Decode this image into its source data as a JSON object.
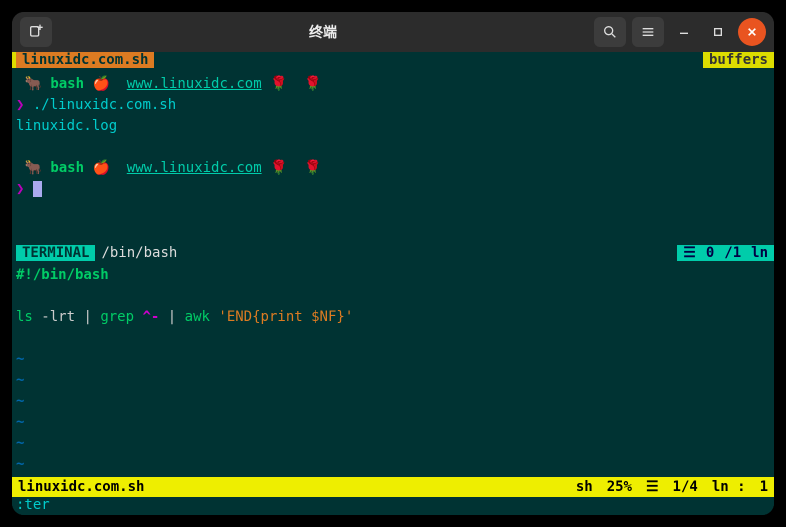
{
  "titlebar": {
    "title": "终端"
  },
  "tabline": {
    "active": "linuxidc.com.sh",
    "right": "buffers"
  },
  "upper": {
    "bash_word": "bash",
    "url": "www.linuxidc.com",
    "prompt_symbol": "❯",
    "command": "./linuxidc.com.sh",
    "output": "linuxidc.log"
  },
  "midbar": {
    "mode": "TERMINAL",
    "path": "/bin/bash",
    "hamburger": "☰",
    "pos": "0",
    "total": "/1",
    "ln": "ln"
  },
  "code": {
    "shebang": "#!/bin/bash",
    "ls": "ls",
    "flags": "-lrt",
    "pipe": "|",
    "grep": "grep",
    "regex": "^-",
    "awk": "awk",
    "awkstr": "'END{print $NF}'",
    "tilde": "~"
  },
  "bottombar": {
    "file": "linuxidc.com.sh",
    "ft": "sh",
    "pct": "25%",
    "hamburger": "☰",
    "pos": "1/4",
    "ln_label": "ln :",
    "col": "1"
  },
  "cmdline": ":ter"
}
